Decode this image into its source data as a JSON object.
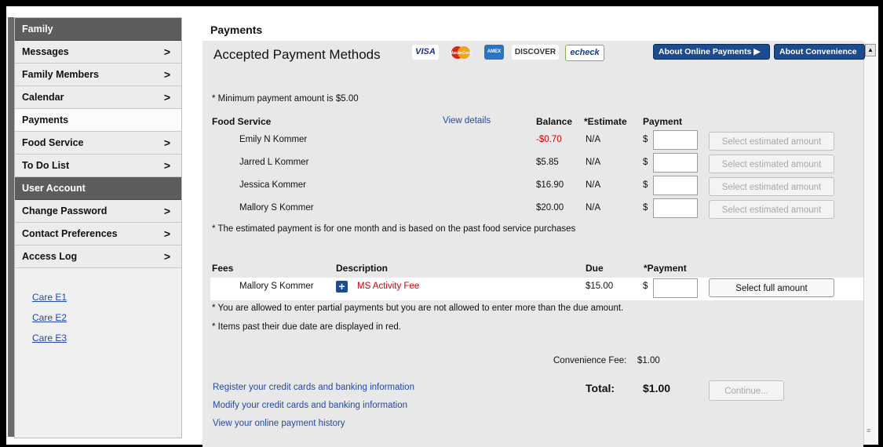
{
  "sidebar": {
    "family_header": "Family",
    "family_items": [
      {
        "label": "Messages",
        "chevron": ">"
      },
      {
        "label": "Family Members",
        "chevron": ">"
      },
      {
        "label": "Calendar",
        "chevron": ">"
      },
      {
        "label": "Payments",
        "chevron": ""
      },
      {
        "label": "Food Service",
        "chevron": ">"
      },
      {
        "label": "To Do List",
        "chevron": ">"
      }
    ],
    "account_header": "User Account",
    "account_items": [
      {
        "label": "Change Password",
        "chevron": ">"
      },
      {
        "label": "Contact Preferences",
        "chevron": ">"
      },
      {
        "label": "Access Log",
        "chevron": ">"
      }
    ],
    "links": [
      "Care E1",
      "Care E2",
      "Care E3"
    ]
  },
  "main": {
    "page_title": "Payments",
    "accepted_title": "Accepted Payment Methods",
    "cards": {
      "visa": "VISA",
      "mastercard": "MasterCard",
      "amex": "AMEX",
      "discover": "DISCOVER",
      "echeck": "echeck"
    },
    "about_online": "About Online Payments ▶",
    "about_convenience": "About Convenience",
    "min_note": "* Minimum payment amount is $5.00",
    "food_service": {
      "header": "Food Service",
      "view_details": "View details",
      "col_balance": "Balance",
      "col_estimate": "*Estimate",
      "col_payment": "Payment",
      "rows": [
        {
          "name": "Emily N Kommer",
          "balance": "-$0.70",
          "estimate": "N/A",
          "currency": "$",
          "button": "Select estimated amount"
        },
        {
          "name": "Jarred L Kommer",
          "balance": "$5.85",
          "estimate": "N/A",
          "currency": "$",
          "button": "Select estimated amount"
        },
        {
          "name": "Jessica  Kommer",
          "balance": "$16.90",
          "estimate": "N/A",
          "currency": "$",
          "button": "Select estimated amount"
        },
        {
          "name": "Mallory S Kommer",
          "balance": "$20.00",
          "estimate": "N/A",
          "currency": "$",
          "button": "Select estimated amount"
        }
      ],
      "note": "* The estimated payment is for one month and is based on the past food service purchases"
    },
    "fees": {
      "header": "Fees",
      "col_description": "Description",
      "col_due": "Due",
      "col_payment": "*Payment",
      "row": {
        "name": "Mallory S Kommer",
        "plus": "+",
        "description": "MS Activity Fee",
        "due": "$15.00",
        "currency": "$",
        "button": "Select full amount"
      },
      "note_partial": "* You are allowed to enter partial payments but you are not allowed to enter more than the due amount.",
      "note_red": "* Items past their due date are displayed in red."
    },
    "convenience_label": "Convenience Fee:",
    "convenience_value": "$1.00",
    "total_label": "Total:",
    "total_value": "$1.00",
    "continue": "Continue...",
    "links": [
      "Register your credit cards and banking information",
      "Modify your credit cards and banking information",
      "View your online payment history"
    ]
  },
  "colors": {
    "accent_blue": "#1c4c8f",
    "header_gray": "#5d5d5d",
    "negative_red": "#cc0000",
    "link_blue": "#2348a8"
  }
}
